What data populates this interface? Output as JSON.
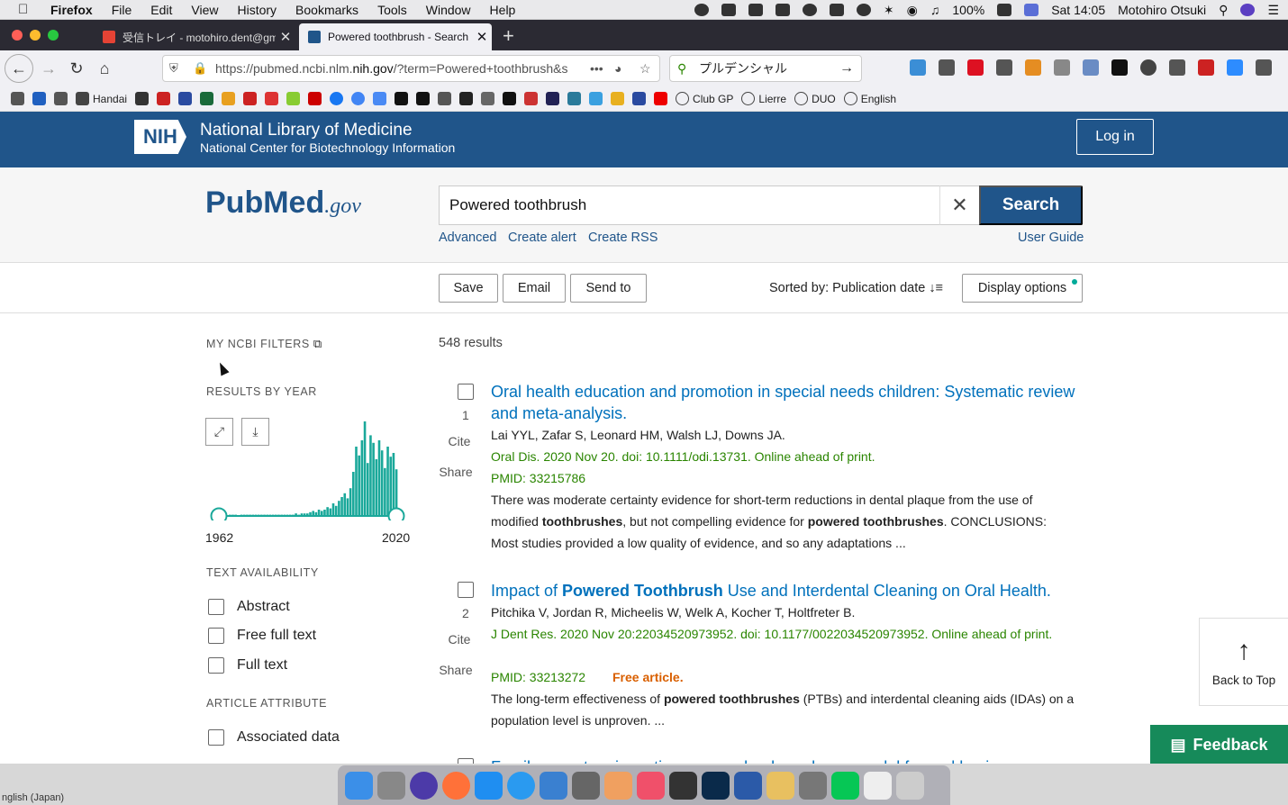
{
  "menubar": {
    "items": [
      "Firefox",
      "File",
      "Edit",
      "View",
      "History",
      "Bookmarks",
      "Tools",
      "Window",
      "Help"
    ],
    "battery": "100%",
    "clock": "Sat 14:05",
    "user": "Motohiro Otsuki"
  },
  "tabs": [
    {
      "label": "受信トレイ - motohiro.dent@gm"
    },
    {
      "label": "Powered toothbrush - Search R"
    }
  ],
  "nav": {
    "url_pre": "https://pubmed.ncbi.nlm.",
    "url_domain": "nih.gov",
    "url_post": "/?term=Powered+toothbrush&s",
    "search_text": "プルデンシャル"
  },
  "bookmarks": [
    "Handai",
    "Club GP",
    "Lierre",
    "DUO",
    "English"
  ],
  "banner": {
    "logo": "NIH",
    "title": "National Library of Medicine",
    "subtitle": "National Center for Biotechnology Information",
    "login": "Log in"
  },
  "search": {
    "logo_main": "PubMed",
    "logo_suffix": ".gov",
    "query": "Powered toothbrush",
    "button": "Search",
    "links": [
      "Advanced",
      "Create alert",
      "Create RSS"
    ],
    "user_guide": "User Guide"
  },
  "actions": {
    "save": "Save",
    "email": "Email",
    "send_to": "Send to",
    "sorted": "Sorted by: Publication date",
    "display": "Display options"
  },
  "sidebar": {
    "my_filters": "MY NCBI FILTERS",
    "results_by_year": "RESULTS BY YEAR",
    "year_start": "1962",
    "year_end": "2020",
    "text_availability": "TEXT AVAILABILITY",
    "text_filters": [
      "Abstract",
      "Free full text",
      "Full text"
    ],
    "article_attribute": "ARTICLE ATTRIBUTE",
    "attribute_filters": [
      "Associated data"
    ]
  },
  "chart_data": {
    "type": "bar",
    "title": "",
    "xlabel": "",
    "ylabel": "",
    "x_range": [
      "1962",
      "2020"
    ],
    "values": [
      1,
      1,
      1,
      0,
      1,
      1,
      1,
      1,
      1,
      1,
      1,
      1,
      1,
      1,
      1,
      1,
      1,
      1,
      1,
      1,
      1,
      1,
      1,
      2,
      1,
      2,
      2,
      2,
      3,
      4,
      3,
      5,
      4,
      5,
      7,
      6,
      10,
      8,
      12,
      15,
      18,
      14,
      22,
      35,
      55,
      48,
      60,
      75,
      42,
      64,
      58,
      45,
      60,
      52,
      38,
      55,
      47,
      50,
      37
    ],
    "color": "#1aa89a"
  },
  "results": {
    "count": "548 results",
    "cite": "Cite",
    "share": "Share",
    "items": [
      {
        "num": "1",
        "title": "Oral health education and promotion in special needs children: Systematic review and meta-analysis.",
        "authors": "Lai YYL, Zafar S, Leonard HM, Walsh LJ, Downs JA.",
        "journal": "Oral Dis. 2020 Nov 20. doi: 10.1111/odi.13731. Online ahead of print.",
        "pmid": "PMID: 33215786",
        "snip_a": "There was moderate certainty evidence for short-term reductions in dental plaque from the use of modified ",
        "snip_b": "toothbrushes",
        "snip_c": ", but not compelling evidence for ",
        "snip_d": "powered toothbrushes",
        "snip_e": ". CONCLUSIONS: Most studies provided a low quality of evidence, and so any adaptations ..."
      },
      {
        "num": "2",
        "title_a": "Impact of ",
        "title_b": "Powered Toothbrush",
        "title_c": " Use and Interdental Cleaning on Oral Health.",
        "authors": "Pitchika V, Jordan R, Micheelis W, Welk A, Kocher T, Holtfreter B.",
        "journal": "J Dent Res. 2020 Nov 20:22034520973952. doi: 10.1177/0022034520973952. Online ahead of print.",
        "pmid": "PMID: 33213272",
        "free": "Free article.",
        "snip_a": "The long-term effectiveness of ",
        "snip_b": "powered toothbrushes",
        "snip_c": " (PTBs) and interdental cleaning aids (IDAs) on a population level is unproven. ..."
      }
    ],
    "partial_title": "Family monetary incentives as a value-based care model for oral hygiene"
  },
  "backtop": "Back to Top",
  "feedback": "Feedback",
  "status": "nglish (Japan)"
}
